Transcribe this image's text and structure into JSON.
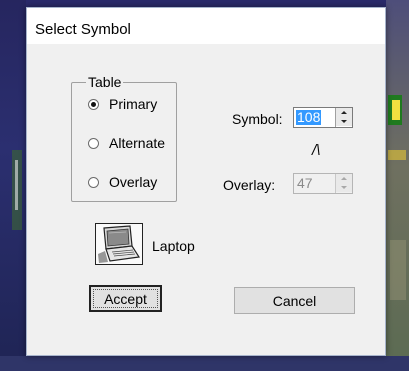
{
  "dialog": {
    "title": "Select Symbol"
  },
  "table_group": {
    "legend": "Table",
    "options": [
      {
        "label": "Primary",
        "checked": true
      },
      {
        "label": "Alternate",
        "checked": false
      },
      {
        "label": "Overlay",
        "checked": false
      }
    ]
  },
  "symbol_field": {
    "label": "Symbol:",
    "value": "108"
  },
  "separator_glyph": "/\\",
  "overlay_field": {
    "label": "Overlay:",
    "value": "47",
    "enabled": false
  },
  "preview": {
    "icon": "laptop-icon",
    "caption": "Laptop"
  },
  "buttons": {
    "accept": "Accept",
    "cancel": "Cancel"
  },
  "colors": {
    "selection": "#3399ff",
    "dialog_bg": "#f0f0f0"
  }
}
